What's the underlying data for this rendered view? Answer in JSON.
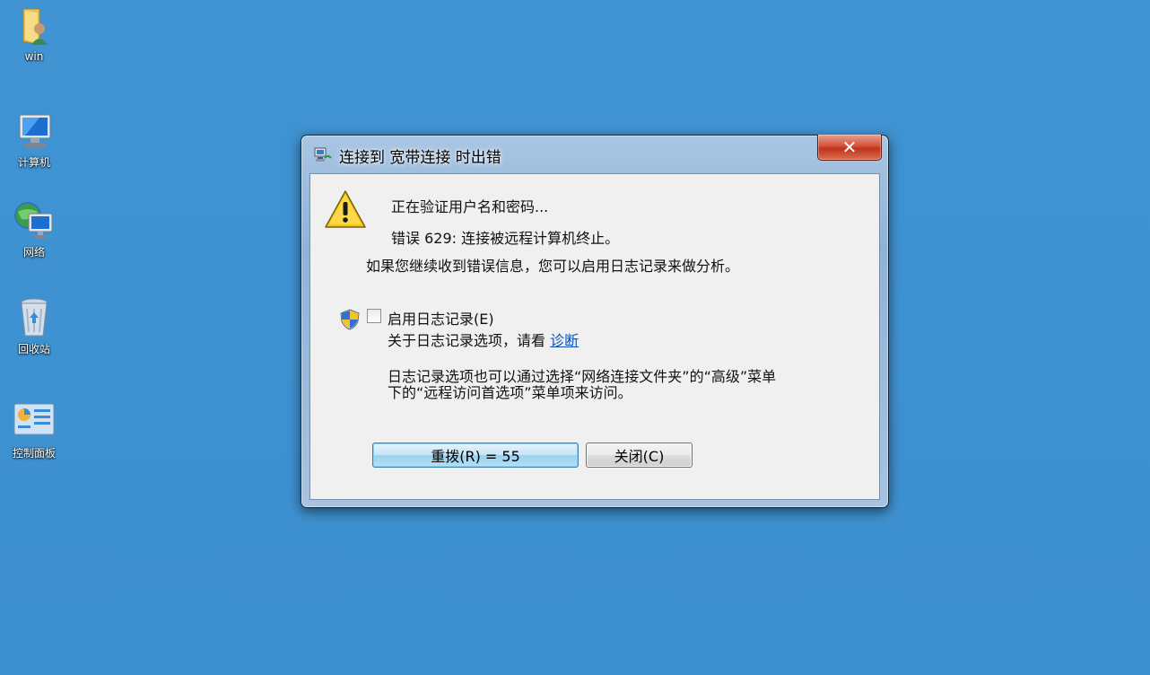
{
  "desktop": {
    "icons": [
      {
        "label": "win",
        "icon": "user-folder-icon"
      },
      {
        "label": "计算机",
        "icon": "computer-icon"
      },
      {
        "label": "网络",
        "icon": "network-icon"
      },
      {
        "label": "回收站",
        "icon": "recycle-bin-icon"
      },
      {
        "label": "控制面板",
        "icon": "control-panel-icon"
      }
    ],
    "background_color": "#3d90cf"
  },
  "dialog": {
    "title": "连接到 宽带连接 时出错",
    "close_label": "✕",
    "message_verify": "正在验证用户名和密码...",
    "message_error": "错误 629: 连接被远程计算机终止。",
    "message_hint": "如果您继续收到错误信息，您可以启用日志记录来做分析。",
    "enable_logging_label": "启用日志记录(E)",
    "enable_logging_checked": false,
    "about_logging_prefix": "关于日志记录选项，请看",
    "diagnostics_link": "诊断",
    "info_line1": "日志记录选项也可以通过选择“网络连接文件夹”的“高级”菜单",
    "info_line2": "下的“远程访问首选项”菜单项来访问。",
    "redial_button": "重拨(R) = 55",
    "close_button": "关闭(C)"
  }
}
